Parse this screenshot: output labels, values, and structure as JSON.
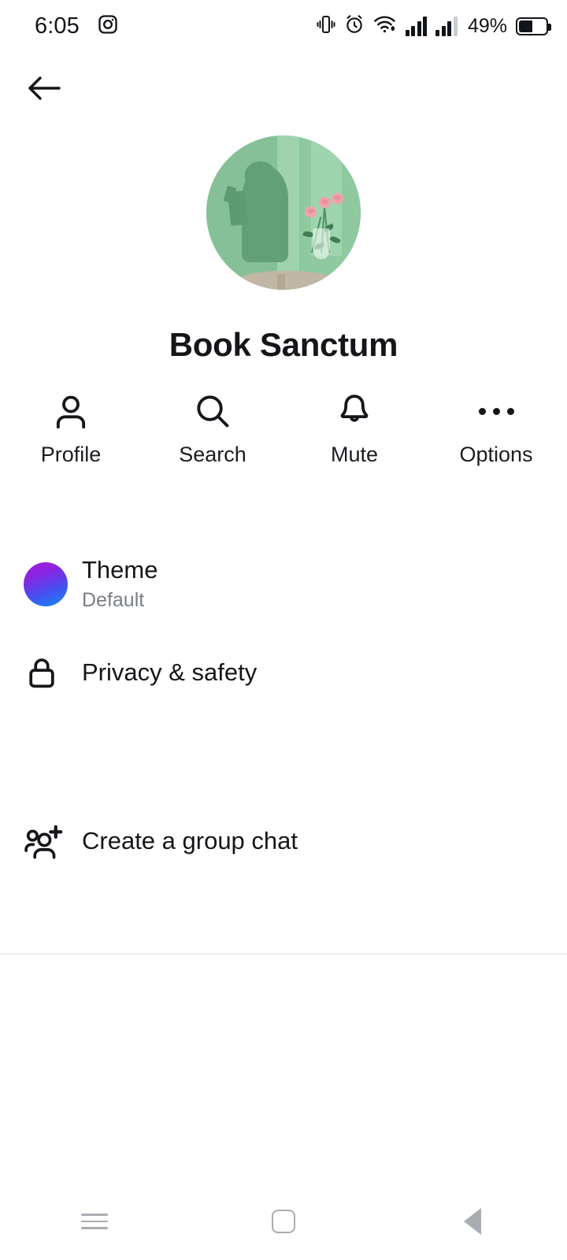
{
  "statusbar": {
    "time": "6:05",
    "battery_percent": "49%",
    "icons": [
      "instagram-icon",
      "vibrate-icon",
      "alarm-icon",
      "wifi-icon",
      "signal-icon",
      "signal-secondary-icon",
      "battery-icon"
    ]
  },
  "header": {
    "back_icon": "back-arrow-icon",
    "avatar_alt": "group-avatar"
  },
  "profile": {
    "name": "Book Sanctum"
  },
  "actions": [
    {
      "label": "Profile",
      "icon": "person-icon"
    },
    {
      "label": "Search",
      "icon": "search-icon"
    },
    {
      "label": "Mute",
      "icon": "bell-icon"
    },
    {
      "label": "Options",
      "icon": "more-horizontal-icon"
    }
  ],
  "settings": {
    "theme": {
      "title": "Theme",
      "value": "Default",
      "swatch_from": "#a41edb",
      "swatch_to": "#0c8cf0",
      "icon": "theme-swatch-icon"
    },
    "privacy": {
      "title": "Privacy & safety",
      "icon": "lock-icon"
    },
    "group": {
      "title": "Create a group chat",
      "icon": "person-add-icon"
    }
  },
  "navbar": {
    "recents": "recents-button",
    "home": "home-button",
    "back": "back-button"
  }
}
